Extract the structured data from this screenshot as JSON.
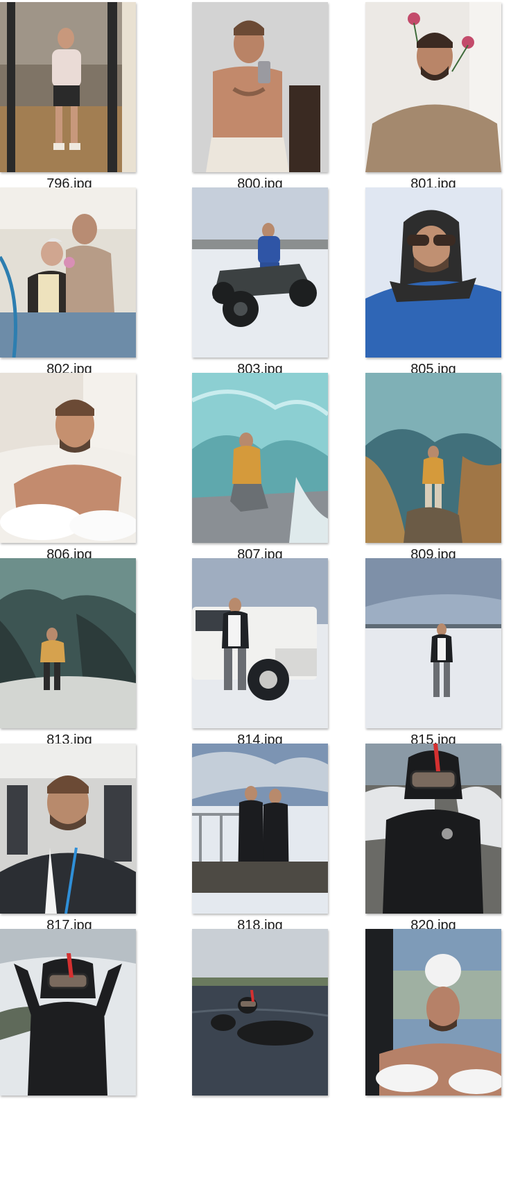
{
  "files": [
    {
      "name": "796.jpg",
      "scene": "gym-mirror",
      "colors": {
        "bg": "#8a7f6f",
        "accent": "#c9b79a",
        "figure": "#e8d6cf"
      }
    },
    {
      "name": "800.jpg",
      "scene": "mirror-selfie",
      "colors": {
        "bg": "#cfcfcf",
        "accent": "#3a2a22",
        "figure": "#c99477"
      }
    },
    {
      "name": "801.jpg",
      "scene": "flowers-selfie",
      "colors": {
        "bg": "#e9e6e2",
        "accent": "#c34b6b",
        "figure": "#a6896f"
      }
    },
    {
      "name": "802.jpg",
      "scene": "sewing-room",
      "colors": {
        "bg": "#e5e1d8",
        "accent": "#3e7ea8",
        "figure": "#b99f88"
      }
    },
    {
      "name": "803.jpg",
      "scene": "atv-snow",
      "colors": {
        "bg": "#c8d0dc",
        "accent": "#2a2d30",
        "figure": "#2f55a6"
      }
    },
    {
      "name": "805.jpg",
      "scene": "balaclava-selfie",
      "colors": {
        "bg": "#dfe6f1",
        "accent": "#2d2d2d",
        "figure": "#2f66b6"
      }
    },
    {
      "name": "806.jpg",
      "scene": "bath",
      "colors": {
        "bg": "#e9e3dc",
        "accent": "#ffffff",
        "figure": "#c38b6e"
      }
    },
    {
      "name": "807.jpg",
      "scene": "ice-cave",
      "colors": {
        "bg": "#5aa3a8",
        "accent": "#9fd3d6",
        "figure": "#d59a3b"
      }
    },
    {
      "name": "809.jpg",
      "scene": "ice-cave-2",
      "colors": {
        "bg": "#3e6d78",
        "accent": "#c3a36a",
        "figure": "#d59a3b"
      }
    },
    {
      "name": "813.jpg",
      "scene": "ice-cave-3",
      "colors": {
        "bg": "#3d5553",
        "accent": "#d3d6d2",
        "figure": "#d6a24e"
      }
    },
    {
      "name": "814.jpg",
      "scene": "land-rover",
      "colors": {
        "bg": "#a3b0c2",
        "accent": "#f0f0ee",
        "figure": "#1f2226"
      }
    },
    {
      "name": "815.jpg",
      "scene": "snow-plain",
      "colors": {
        "bg": "#9fb0c4",
        "accent": "#e6e9ee",
        "figure": "#1d1f22"
      }
    },
    {
      "name": "817.jpg",
      "scene": "van-selfie",
      "colors": {
        "bg": "#d6d6d4",
        "accent": "#2b2e33",
        "figure": "#b88a6c"
      }
    },
    {
      "name": "818.jpg",
      "scene": "two-divers",
      "colors": {
        "bg": "#7c94b3",
        "accent": "#e7ecf2",
        "figure": "#1b1c1f"
      }
    },
    {
      "name": "820.jpg",
      "scene": "snorkel-suit",
      "colors": {
        "bg": "#8b9aa6",
        "accent": "#d43030",
        "figure": "#1a1b1d"
      }
    },
    {
      "name": "",
      "scene": "snorkel-wave",
      "colors": {
        "bg": "#b7bfc5",
        "accent": "#e3e7ea",
        "figure": "#1d1e20"
      }
    },
    {
      "name": "",
      "scene": "snorkel-float",
      "colors": {
        "bg": "#6d7883",
        "accent": "#3b4450",
        "figure": "#1b1c1d"
      }
    },
    {
      "name": "",
      "scene": "hot-tub",
      "colors": {
        "bg": "#7e9bb8",
        "accent": "#f2f2f2",
        "figure": "#b68168"
      }
    }
  ]
}
